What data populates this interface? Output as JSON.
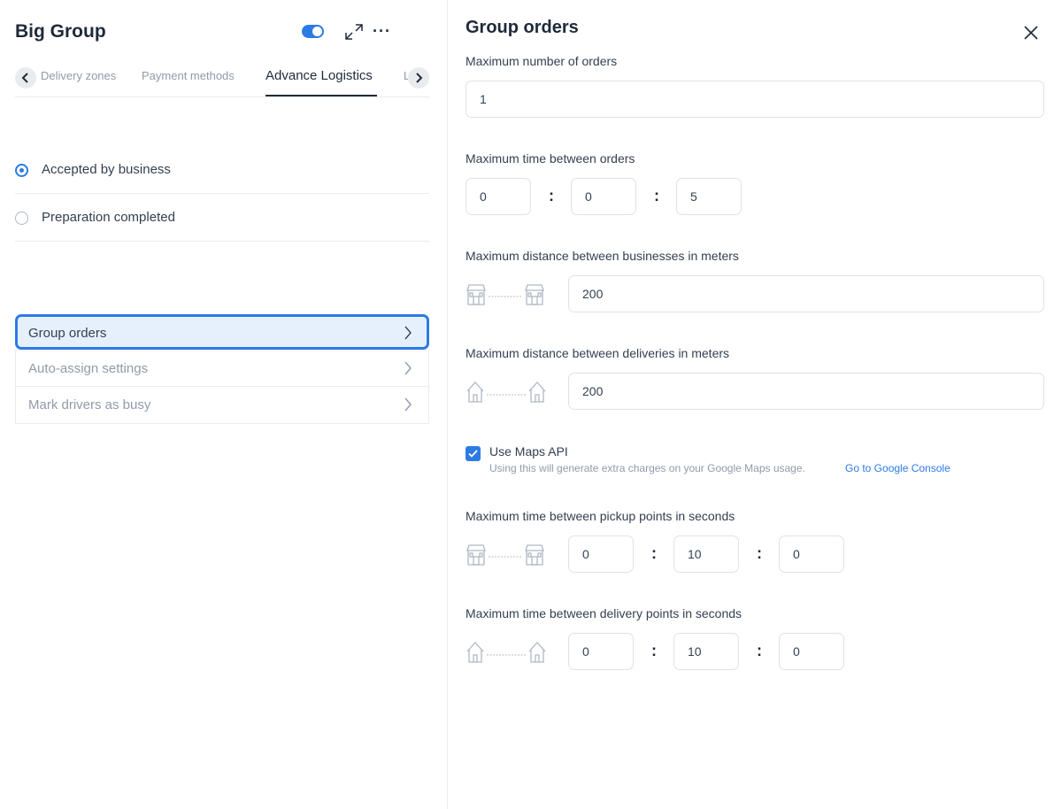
{
  "business": {
    "title": "Big Group",
    "enabled": true
  },
  "tabs": {
    "items": [
      "Delivery zones",
      "Payment methods",
      "Advance Logistics",
      "L"
    ],
    "active": "Advance Logistics"
  },
  "order_status": [
    {
      "label": "Accepted by business",
      "checked": true
    },
    {
      "label": "Preparation completed",
      "checked": false
    }
  ],
  "menu": [
    {
      "label": "Group orders",
      "selected": true
    },
    {
      "label": "Auto-assign settings",
      "selected": false
    },
    {
      "label": "Mark drivers as busy",
      "selected": false
    }
  ],
  "panel": {
    "title": "Group orders",
    "max_orders": {
      "label": "Maximum number of orders",
      "value": "1"
    },
    "max_time_orders": {
      "label": "Maximum time between orders",
      "hours": "0",
      "minutes": "0",
      "seconds": "5"
    },
    "max_dist_businesses": {
      "label": "Maximum distance between businesses in meters",
      "value": "200"
    },
    "max_dist_deliveries": {
      "label": "Maximum distance between deliveries in meters",
      "value": "200"
    },
    "maps_api": {
      "label": "Use Maps API",
      "checked": true,
      "hint": "Using this will generate extra charges on your Google Maps usage.",
      "link": "Go to Google Console"
    },
    "max_time_pickup": {
      "label": "Maximum time between pickup points in seconds",
      "hours": "0",
      "minutes": "10",
      "seconds": "0"
    },
    "max_time_delivery": {
      "label": "Maximum time between delivery points in seconds",
      "hours": "0",
      "minutes": "10",
      "seconds": "0"
    },
    "separator": ":"
  },
  "icons": {
    "toggle": "toggle-switch",
    "expand": "expand-arrows-icon",
    "more": "more-dots-icon",
    "close": "close-icon",
    "store": "store-icon",
    "house": "house-icon",
    "chevron": "chevron-right-icon"
  },
  "colors": {
    "accent": "#2c7be5",
    "selected_bg": "#e6f0fd",
    "muted_text": "#909ba9"
  }
}
